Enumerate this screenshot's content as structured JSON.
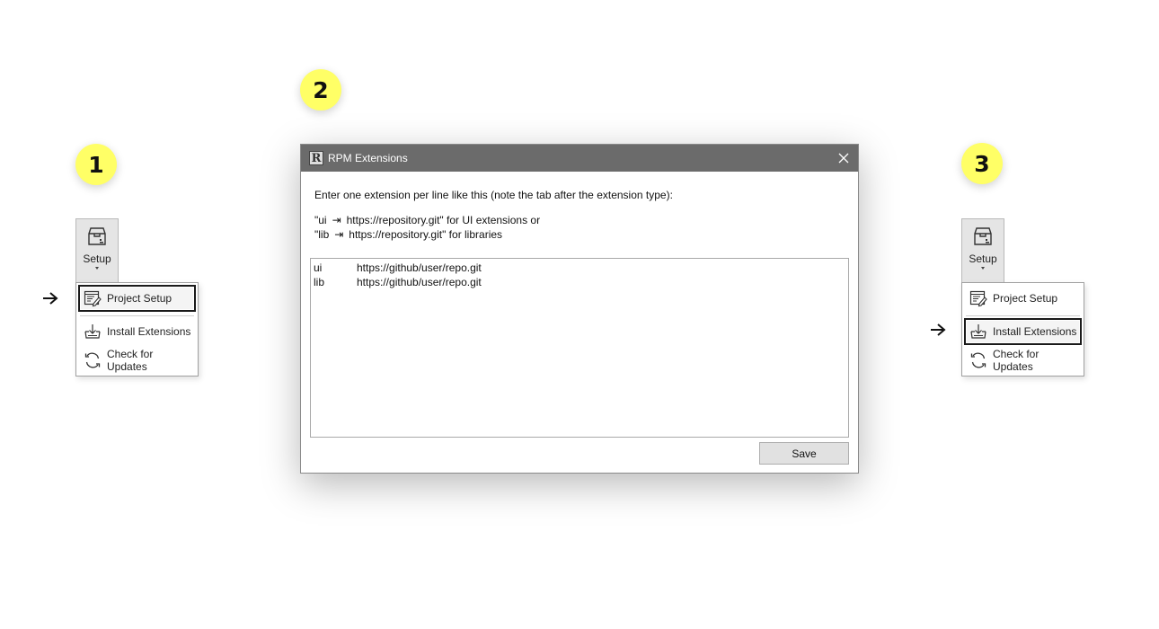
{
  "steps": {
    "one": "1",
    "two": "2",
    "three": "3"
  },
  "ribbon": {
    "setup_label": "Setup"
  },
  "menu": {
    "items": [
      {
        "label": "Project Setup",
        "icon": "project-setup-icon"
      },
      {
        "label": "Install Extensions",
        "icon": "install-extensions-icon"
      },
      {
        "label": "Check for Updates",
        "icon": "refresh-icon"
      }
    ],
    "step1_selected": "Project Setup",
    "step3_selected": "Install Extensions"
  },
  "dialog": {
    "title": "RPM Extensions",
    "app_icon_letter": "R",
    "instructions": "Enter one extension per line like this (note the tab after the extension type):",
    "example_lines": [
      {
        "type": "\"ui",
        "tab": "⇥",
        "rest": "https://repository.git\" for UI extensions or"
      },
      {
        "type": "\"lib",
        "tab": "⇥",
        "rest": "https://repository.git\" for libraries"
      }
    ],
    "textarea_lines": [
      {
        "type": "ui",
        "url": "https://github/user/repo.git"
      },
      {
        "type": "lib",
        "url": "https://github/user/repo.git"
      }
    ],
    "save_label": "Save"
  },
  "colors": {
    "badge": "#ffff66",
    "titlebar": "#6b6b6b",
    "ribbon_button": "#e5e5e5"
  }
}
